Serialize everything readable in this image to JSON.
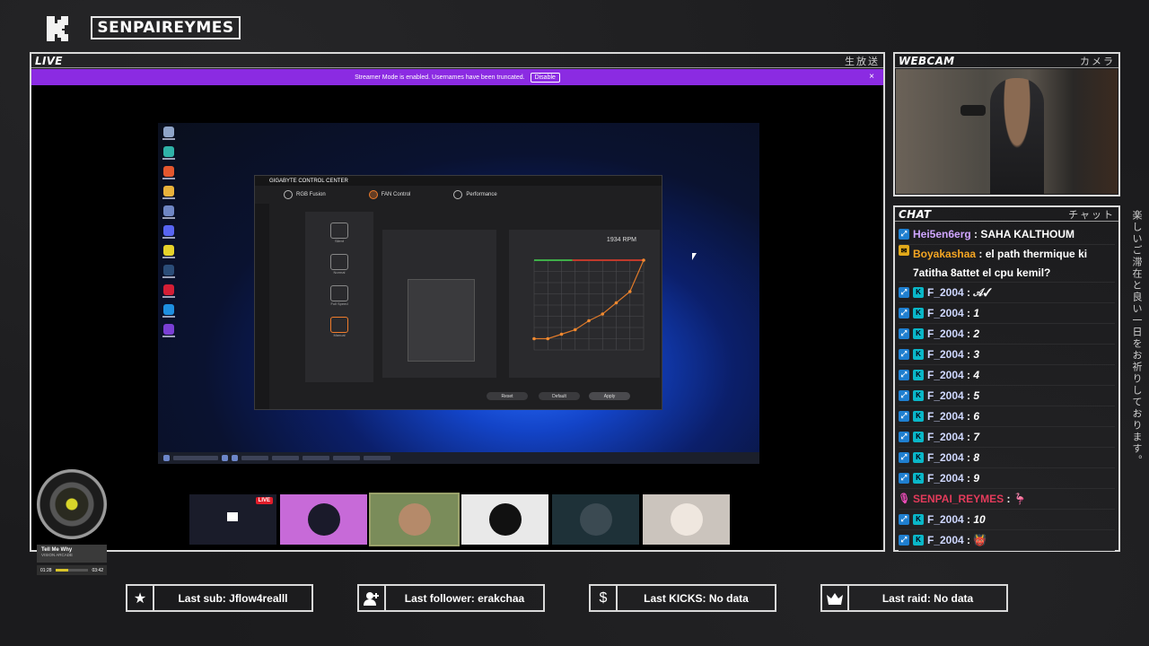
{
  "brand": {
    "name": "SENPAIREYMES"
  },
  "live_panel": {
    "title": "LIVE",
    "jp": "生放送",
    "banner": {
      "message": "Streamer Mode is enabled. Usernames have been truncated.",
      "action": "Disable",
      "close": "×"
    }
  },
  "desktop": {
    "app": {
      "title": "GIGABYTE CONTROL CENTER",
      "tabs": [
        {
          "label": "RGB Fusion",
          "active": false
        },
        {
          "label": "FAN Control",
          "active": true
        },
        {
          "label": "Performance",
          "active": false
        }
      ],
      "fan_modes": [
        "Silent",
        "Normal",
        "Full Speed",
        "Manual"
      ],
      "rpm": "1934 RPM",
      "buttons": {
        "reset": "Reset",
        "default": "Default",
        "apply": "Apply"
      },
      "fan_curve": {
        "x": [
          20,
          30,
          40,
          50,
          60,
          70,
          80,
          90,
          100
        ],
        "y": [
          30,
          30,
          34,
          38,
          46,
          52,
          62,
          72,
          100
        ]
      }
    }
  },
  "scene_tiles": [
    {
      "name": "tile-desktop",
      "live_label": "LIVE",
      "bg": "#1a1c2a"
    },
    {
      "name": "tile-anime",
      "bg": "#c76ad8"
    },
    {
      "name": "tile-face",
      "bg": "#7a8c5a"
    },
    {
      "name": "tile-wolf",
      "bg": "#e9e9e9"
    },
    {
      "name": "tile-portrait",
      "bg": "#1e3138"
    },
    {
      "name": "tile-hamster",
      "bg": "#cbc4bd"
    }
  ],
  "music": {
    "song": "Tell Me Why",
    "artist": "VISION ARCADE",
    "elapsed": "01:28",
    "duration": "03:42",
    "progress": 0.4
  },
  "webcam_panel": {
    "title": "WEBCAM",
    "jp": "カメラ"
  },
  "chat_panel": {
    "title": "CHAT",
    "jp": "チャット",
    "side_text": "楽しいご滞在と良い一日をお祈りしております。",
    "messages": [
      {
        "badge": "twitch",
        "user": "Hei5en6erg",
        "color": "#cfa5ff",
        "text": "SAHA KALTHOUM"
      },
      {
        "badge": "yellow",
        "user": "Boyakashaa",
        "color": "#f5a623",
        "text": "el path thermique ki 7atitha 8attet el cpu kemil?"
      },
      {
        "badge": "kick",
        "user": "F_2004",
        "color": "#cfd8ff",
        "text": "𝒜✓"
      },
      {
        "badge": "kick",
        "user": "F_2004",
        "color": "#cfd8ff",
        "text": "1"
      },
      {
        "badge": "kick",
        "user": "F_2004",
        "color": "#cfd8ff",
        "text": "2"
      },
      {
        "badge": "kick",
        "user": "F_2004",
        "color": "#cfd8ff",
        "text": "3"
      },
      {
        "badge": "kick",
        "user": "F_2004",
        "color": "#cfd8ff",
        "text": "4"
      },
      {
        "badge": "kick",
        "user": "F_2004",
        "color": "#cfd8ff",
        "text": "5"
      },
      {
        "badge": "kick",
        "user": "F_2004",
        "color": "#cfd8ff",
        "text": "6"
      },
      {
        "badge": "kick",
        "user": "F_2004",
        "color": "#cfd8ff",
        "text": "7"
      },
      {
        "badge": "kick",
        "user": "F_2004",
        "color": "#cfd8ff",
        "text": "8"
      },
      {
        "badge": "kick",
        "user": "F_2004",
        "color": "#cfd8ff",
        "text": "9"
      },
      {
        "badge": "mic",
        "user": "SENPAI_REYMES",
        "color": "#e33b5b",
        "text": "🦩"
      },
      {
        "badge": "kick",
        "user": "F_2004",
        "color": "#cfd8ff",
        "text": "10"
      },
      {
        "badge": "kick",
        "user": "F_2004",
        "color": "#cfd8ff",
        "text": "👹"
      }
    ]
  },
  "stats": {
    "last_sub": "Last sub: Jflow4realll",
    "last_follower": "Last follower: erakchaa",
    "last_kicks": "Last KICKS: No data",
    "last_raid": "Last raid: No data"
  }
}
